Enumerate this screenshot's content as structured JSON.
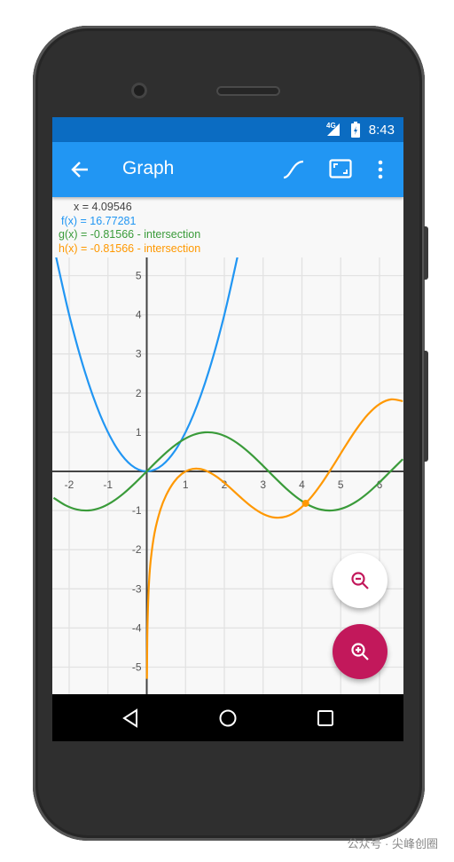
{
  "status_bar": {
    "network": "4G",
    "time": "8:43"
  },
  "app_bar": {
    "title": "Graph",
    "back_icon": "arrow-left-icon",
    "actions": [
      "curve-icon",
      "fit-screen-icon",
      "more-vert-icon"
    ]
  },
  "readout": {
    "x": "x = 4.09546",
    "f": "f(x) = 16.77281",
    "g": "g(x) = -0.81566 - intersection",
    "h": "h(x) = -0.81566 - intersection"
  },
  "colors": {
    "f": "#2196f3",
    "g": "#3a9b3a",
    "h": "#ff9800",
    "axis": "#444444",
    "grid": "#e2e2e2",
    "fab_zoom_in": "#c2185b",
    "app_bar": "#2196f3",
    "status_bar": "#0b6cc2"
  },
  "chart_data": {
    "type": "line",
    "xlim": [
      -2.4,
      6.6
    ],
    "ylim": [
      -5.7,
      5.5
    ],
    "grid": true,
    "x_ticks": [
      "-2",
      "-1",
      "1",
      "2",
      "3",
      "4",
      "5",
      "6"
    ],
    "y_ticks": [
      "5",
      "4",
      "3",
      "2",
      "1",
      "-1",
      "-2",
      "-3",
      "-4",
      "-5"
    ],
    "series": [
      {
        "name": "f(x)",
        "color": "#2196f3",
        "x": [
          -2.4,
          -2,
          -1.6,
          -1.2,
          -0.8,
          -0.4,
          0,
          0.4,
          0.8,
          1.2,
          1.6,
          2,
          2.4
        ],
        "y": [
          5.76,
          4,
          2.56,
          1.44,
          0.64,
          0.16,
          0,
          0.16,
          0.64,
          1.44,
          2.56,
          4,
          5.76
        ]
      },
      {
        "name": "g(x)",
        "color": "#3a9b3a",
        "x": [
          -2.4,
          -2.1,
          -1.8,
          -1.5,
          -1.2,
          -0.9,
          -0.6,
          -0.3,
          0,
          0.3,
          0.6,
          0.9,
          1.2,
          1.5,
          1.8,
          2.1,
          2.4,
          2.7,
          3.0,
          3.3,
          3.6,
          3.9,
          4.2,
          4.5,
          4.8,
          5.1,
          5.4,
          5.7,
          6.0,
          6.3,
          6.6
        ],
        "y": [
          -0.675,
          -0.863,
          -0.974,
          -0.997,
          -0.932,
          -0.783,
          -0.565,
          -0.296,
          0,
          0.296,
          0.565,
          0.783,
          0.932,
          0.997,
          0.974,
          0.863,
          0.675,
          0.427,
          0.141,
          -0.158,
          -0.443,
          -0.688,
          -0.872,
          -0.978,
          -0.996,
          -0.926,
          -0.773,
          -0.551,
          -0.279,
          0.017,
          0.312
        ]
      },
      {
        "name": "h(x)",
        "color": "#ff9800",
        "x": [
          0.005,
          0.01,
          0.02,
          0.05,
          0.1,
          0.2,
          0.35,
          0.5,
          0.7,
          0.9,
          1.1,
          1.3,
          1.5,
          1.8,
          2.1,
          2.4,
          2.7,
          3.0,
          3.3,
          3.6,
          3.9,
          4.2,
          4.5,
          4.8,
          5.1,
          5.4,
          5.7,
          6.0,
          6.3,
          6.6
        ],
        "y": [
          -5.298,
          -4.605,
          -3.911,
          -2.993,
          -2.291,
          -1.577,
          -0.986,
          -0.608,
          -0.273,
          -0.066,
          0.043,
          0.07,
          0.029,
          -0.134,
          -0.375,
          -0.646,
          -0.898,
          -1.088,
          -1.179,
          -1.149,
          -0.988,
          -0.704,
          -0.317,
          0.137,
          0.616,
          1.07,
          1.453,
          1.72,
          1.84,
          1.793
        ]
      }
    ],
    "highlight_point": {
      "x": 4.09546,
      "y": -0.81566,
      "label": "intersection"
    }
  },
  "fabs": {
    "zoom_out": "zoom-out-icon",
    "zoom_in": "zoom-in-icon"
  },
  "nav_bar": [
    "back-icon",
    "home-icon",
    "recents-icon"
  ],
  "watermark": "公众号 · 尖峰创圈"
}
